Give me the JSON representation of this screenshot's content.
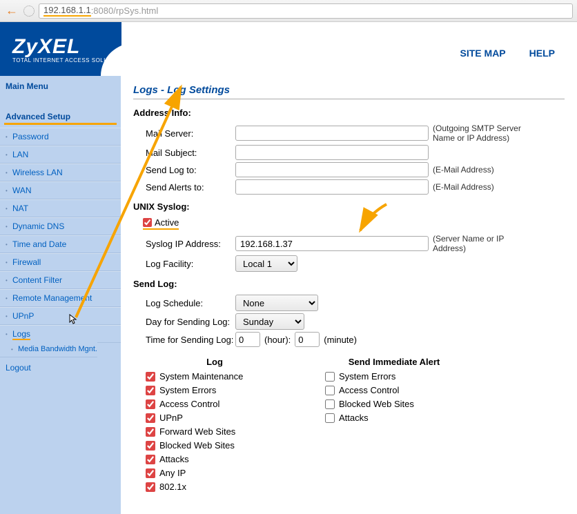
{
  "url": {
    "host": "192.168.1.1",
    "port": ":8080",
    "path": "/rpSys.html"
  },
  "brand": {
    "name": "ZyXEL",
    "tagline": "TOTAL INTERNET ACCESS SOLUTION"
  },
  "topnav": {
    "sitemap": "SITE MAP",
    "help": "HELP"
  },
  "sidebar": {
    "main": "Main Menu",
    "advanced": "Advanced Setup",
    "items": [
      "Password",
      "LAN",
      "Wireless LAN",
      "WAN",
      "NAT",
      "Dynamic DNS",
      "Time and Date",
      "Firewall",
      "Content Filter",
      "Remote Management",
      "UPnP",
      "Logs"
    ],
    "sub": "Media Bandwidth Mgnt.",
    "logout": "Logout"
  },
  "page": {
    "title": "Logs - Log Settings",
    "address_info": "Address Info:",
    "mail_server": "Mail Server:",
    "mail_server_note": "(Outgoing SMTP Server Name or IP Address)",
    "mail_subject": "Mail Subject:",
    "send_log_to": "Send Log to:",
    "email_note": "(E-Mail Address)",
    "send_alerts_to": "Send Alerts to:",
    "unix_syslog": "UNIX Syslog:",
    "active": "Active",
    "syslog_ip": "Syslog IP Address:",
    "syslog_ip_value": "192.168.1.37",
    "server_note": "(Server Name or IP Address)",
    "log_facility": "Log Facility:",
    "log_facility_value": "Local 1",
    "send_log": "Send Log:",
    "log_schedule": "Log Schedule:",
    "log_schedule_value": "None",
    "day_label": "Day for Sending Log:",
    "day_value": "Sunday",
    "time_label": "Time for Sending Log:",
    "time_hour": "0",
    "hour_label": "(hour):",
    "time_min": "0",
    "min_label": "(minute)",
    "log_header": "Log",
    "alert_header": "Send Immediate Alert",
    "logs": [
      "System Maintenance",
      "System Errors",
      "Access Control",
      "UPnP",
      "Forward Web Sites",
      "Blocked Web Sites",
      "Attacks",
      "Any IP",
      "802.1x"
    ],
    "alerts": [
      "System Errors",
      "Access Control",
      "Blocked Web Sites",
      "Attacks"
    ]
  }
}
